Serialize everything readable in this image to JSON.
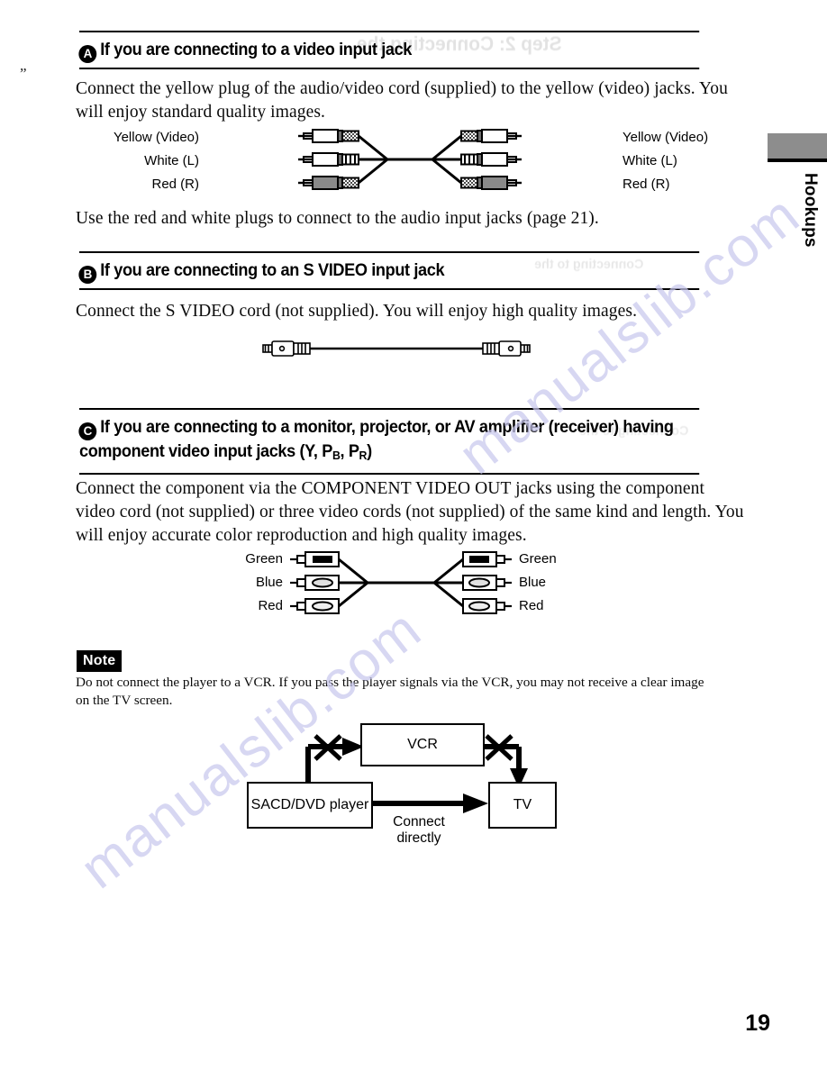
{
  "page": {
    "number": "19",
    "side_tab_label": "Hookups",
    "watermark": "manualslib.com",
    "margin_artifact": "”"
  },
  "ghost_text": {
    "top": "Step 2: Connecting the",
    "mid": "Connecting to the"
  },
  "sections": [
    {
      "id": "a",
      "bullet": "A",
      "heading": "If you are connecting to a video input jack",
      "body": "Connect the yellow plug of the audio/video cord (supplied) to the yellow (video) jacks. You will enjoy standard quality images.",
      "after": "Use the red and white plugs to connect to the audio input jacks (page 21)."
    },
    {
      "id": "b",
      "bullet": "B",
      "heading": "If you are connecting to an S VIDEO input jack",
      "body": "Connect the S VIDEO cord (not supplied). You will enjoy high quality images."
    },
    {
      "id": "c",
      "bullet": "C",
      "heading_line1": "If you are connecting to a monitor, projector, or AV amplifier (receiver) having",
      "heading_line2_pre": "component video input jacks (Y, P",
      "heading_line2_sub1": "B",
      "heading_line2_mid": ", P",
      "heading_line2_sub2": "R",
      "heading_line2_post": ")",
      "body": "Connect the component via the COMPONENT VIDEO OUT jacks using the component video cord (not supplied) or three video cords (not supplied) of the same kind and length. You will enjoy accurate color reproduction and high quality images."
    }
  ],
  "av_cable_diagram": {
    "left_labels": [
      "Yellow (Video)",
      "White (L)",
      "Red (R)"
    ],
    "right_labels": [
      "Yellow (Video)",
      "White (L)",
      "Red (R)"
    ],
    "plug_fills": [
      "white",
      "white",
      "gray"
    ]
  },
  "svideo_diagram": {
    "description": "S VIDEO cord with mini-DIN connectors at both ends"
  },
  "component_cable_diagram": {
    "left_labels": [
      "Green",
      "Blue",
      "Red"
    ],
    "right_labels": [
      "Green",
      "Blue",
      "Red"
    ]
  },
  "note": {
    "badge": "Note",
    "text": "Do not connect the player to a VCR. If you pass the player signals via the VCR, you may not receive a clear image on the TV screen."
  },
  "block_diagram": {
    "boxes": [
      {
        "name": "vcr",
        "label": "VCR"
      },
      {
        "name": "player",
        "label": "SACD/DVD player"
      },
      {
        "name": "tv",
        "label": "TV"
      }
    ],
    "annotation": "Connect\ndirectly",
    "annotation_line1": "Connect",
    "annotation_line2": "directly",
    "forbidden_marks": 2
  },
  "colors": {
    "ink": "#0a0a0a",
    "tab_gray": "#8d8d8d",
    "watermark": "#c9c8ee",
    "plug_gray": "#8a8a8a"
  }
}
